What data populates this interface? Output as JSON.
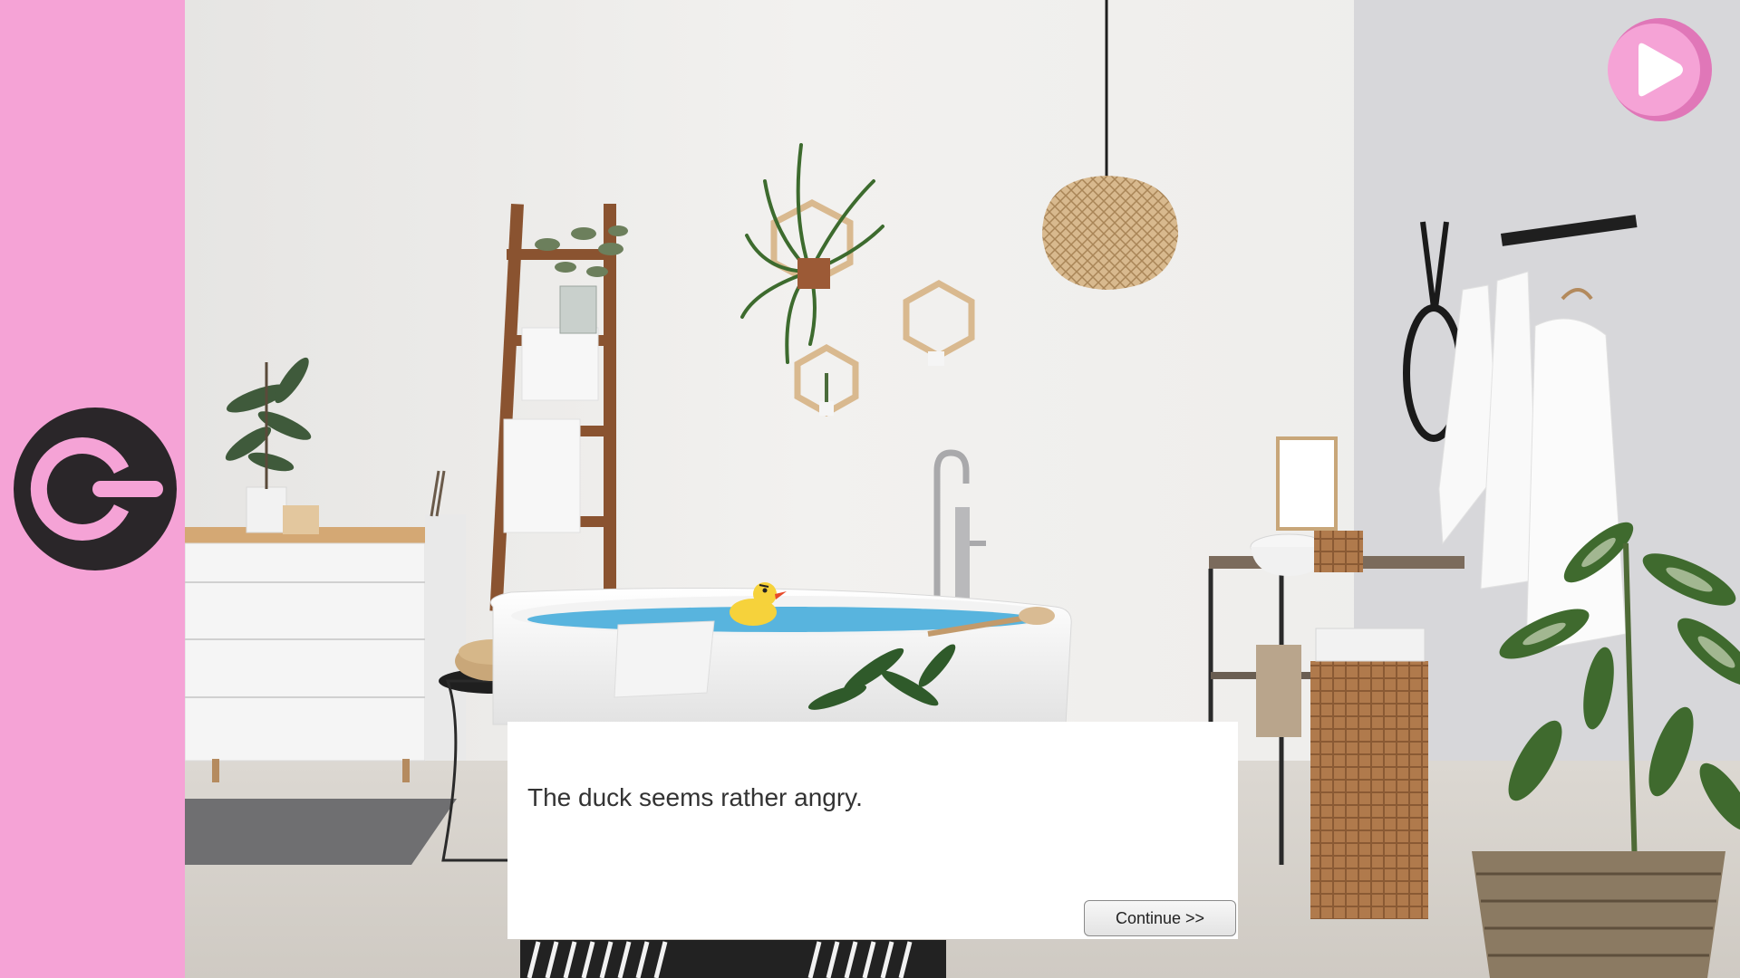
{
  "colors": {
    "sidebar": "#f5a3d6",
    "icon_dark": "#2a2629",
    "play_light": "#f5a3d6",
    "play_dark": "#e077b8",
    "water": "#58b4de"
  },
  "sidebar": {
    "power_icon": "power-icon"
  },
  "top_right": {
    "play_icon": "play-icon"
  },
  "dialog": {
    "text": "The duck seems rather angry.",
    "continue_label": "Continue >>"
  }
}
